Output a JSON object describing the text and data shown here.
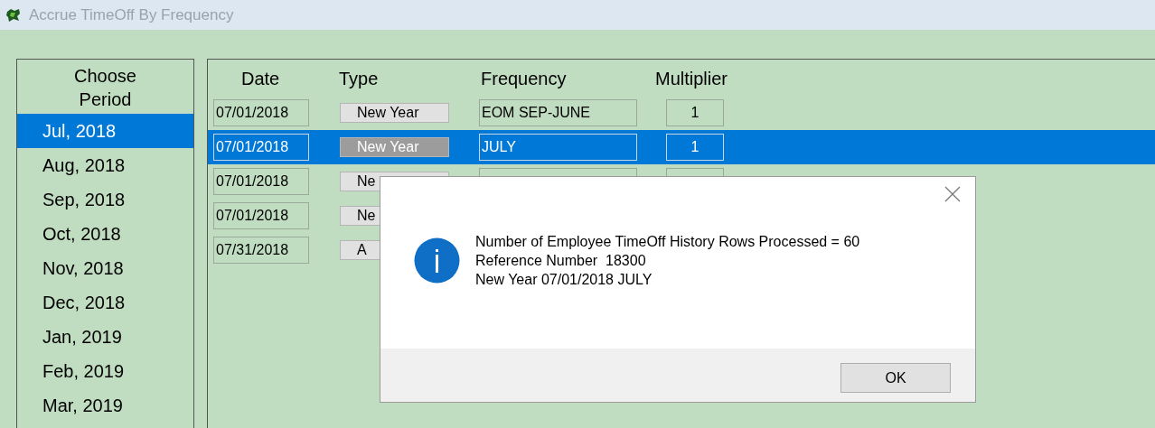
{
  "window": {
    "title": "Accrue TimeOff By Frequency"
  },
  "period_panel": {
    "heading_lines": [
      "Choose",
      "Period"
    ],
    "items": [
      {
        "label": "Jul, 2018",
        "selected": true
      },
      {
        "label": "Aug, 2018",
        "selected": false
      },
      {
        "label": "Sep, 2018",
        "selected": false
      },
      {
        "label": "Oct, 2018",
        "selected": false
      },
      {
        "label": "Nov, 2018",
        "selected": false
      },
      {
        "label": "Dec, 2018",
        "selected": false
      },
      {
        "label": "Jan, 2019",
        "selected": false
      },
      {
        "label": "Feb, 2019",
        "selected": false
      },
      {
        "label": "Mar, 2019",
        "selected": false
      }
    ]
  },
  "table": {
    "columns": [
      "Date",
      "Type",
      "Frequency",
      "Multiplier"
    ],
    "rows": [
      {
        "date": "07/01/2018",
        "type": "New Year",
        "frequency": "EOM SEP-JUNE",
        "multiplier": "1",
        "selected": false
      },
      {
        "date": "07/01/2018",
        "type": "New Year",
        "frequency": "JULY",
        "multiplier": "1",
        "selected": true
      },
      {
        "date": "07/01/2018",
        "type": "Ne",
        "selected": false
      },
      {
        "date": "07/01/2018",
        "type": "Ne",
        "selected": false
      },
      {
        "date": "07/31/2018",
        "type": "A",
        "selected": false
      }
    ]
  },
  "dialog": {
    "lines": [
      "Number of Employee TimeOff History Rows Processed = 60",
      "Reference Number  18300",
      "New Year 07/01/2018 JULY"
    ],
    "ok_button": "OK"
  }
}
